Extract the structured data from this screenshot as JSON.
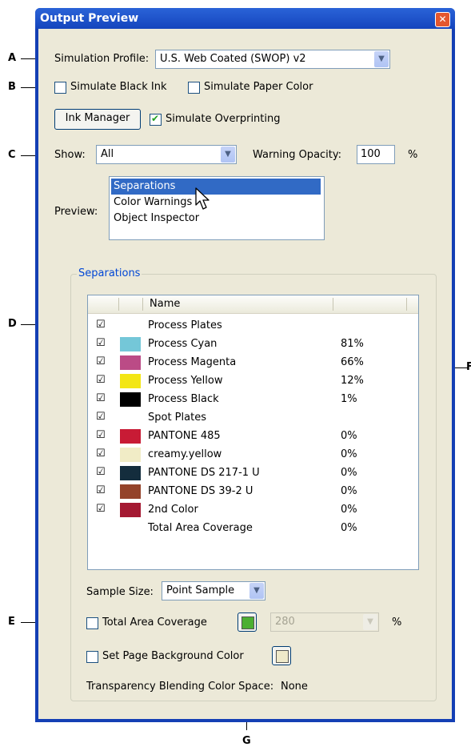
{
  "window": {
    "title": "Output Preview"
  },
  "callouts": {
    "a": "A",
    "b": "B",
    "c": "C",
    "d": "D",
    "e": "E",
    "f": "F",
    "g": "G"
  },
  "simulation_profile": {
    "label": "Simulation Profile:",
    "value": "U.S. Web Coated (SWOP) v2"
  },
  "simulate_black_ink": {
    "label": "Simulate Black Ink",
    "checked": false
  },
  "simulate_paper_color": {
    "label": "Simulate Paper Color",
    "checked": false
  },
  "ink_manager_button": "Ink Manager",
  "simulate_overprinting": {
    "label": "Simulate Overprinting",
    "checked": true
  },
  "show": {
    "label": "Show:",
    "value": "All"
  },
  "warning_opacity": {
    "label": "Warning Opacity:",
    "value": "100",
    "unit": "%"
  },
  "preview": {
    "label": "Preview:",
    "items": [
      "Separations",
      "Color Warnings",
      "Object Inspector"
    ],
    "selected": "Separations"
  },
  "separations_group": {
    "title": "Separations",
    "column_name": "Name",
    "rows": [
      {
        "name": "Process Plates",
        "checked": true,
        "swatch": null,
        "pct": ""
      },
      {
        "name": "Process Cyan",
        "checked": true,
        "swatch": "#74c7d8",
        "pct": "81%"
      },
      {
        "name": "Process Magenta",
        "checked": true,
        "swatch": "#bb4b86",
        "pct": "66%"
      },
      {
        "name": "Process Yellow",
        "checked": true,
        "swatch": "#f3e614",
        "pct": "12%"
      },
      {
        "name": "Process Black",
        "checked": true,
        "swatch": "#000000",
        "pct": "1%"
      },
      {
        "name": "Spot Plates",
        "checked": true,
        "swatch": null,
        "pct": ""
      },
      {
        "name": "PANTONE 485",
        "checked": true,
        "swatch": "#c81b35",
        "pct": "0%"
      },
      {
        "name": "creamy.yellow",
        "checked": true,
        "swatch": "#f1ecc6",
        "pct": "0%"
      },
      {
        "name": "PANTONE DS 217-1 U",
        "checked": true,
        "swatch": "#142d3d",
        "pct": "0%"
      },
      {
        "name": "PANTONE DS 39-2 U",
        "checked": true,
        "swatch": "#94432a",
        "pct": "0%"
      },
      {
        "name": "2nd Color",
        "checked": true,
        "swatch": "#a41932",
        "pct": "0%"
      },
      {
        "name": "Total Area Coverage",
        "checked": false,
        "swatch": null,
        "pct": "0%"
      }
    ]
  },
  "sample_size": {
    "label": "Sample Size:",
    "value": "Point Sample"
  },
  "total_area_coverage": {
    "label": "Total Area Coverage",
    "checked": false,
    "color": "#4caf32",
    "value": "280",
    "unit": "%"
  },
  "page_background": {
    "label": "Set Page Background Color",
    "checked": false,
    "color": "#efe9c9"
  },
  "transparency": {
    "label": "Transparency Blending Color Space:",
    "value": "None"
  },
  "colors": {
    "title_bar": "#1545bd",
    "selection": "#316ac5",
    "dialog_bg": "#ece9d8"
  }
}
